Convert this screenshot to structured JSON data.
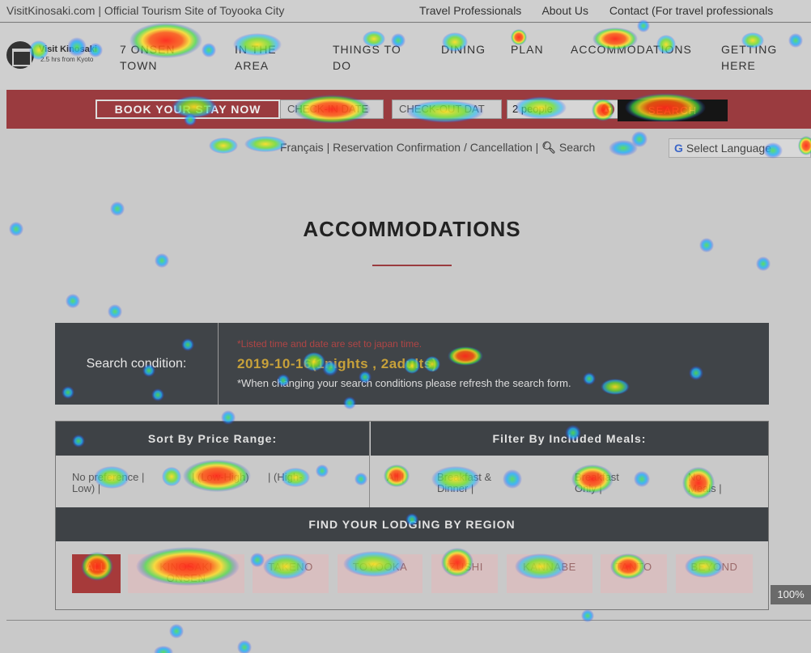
{
  "topbar": {
    "site_title": "VisitKinosaki.com | Official Tourism Site of Toyooka City",
    "links": [
      "Travel Professionals",
      "About Us",
      "Contact (For travel professionals"
    ]
  },
  "logo": {
    "name": "Visit Kinosaki",
    "tagline": "2.5 hrs from Kyoto"
  },
  "nav": {
    "items": [
      {
        "line1": "7 ONSEN",
        "line2": "TOWN"
      },
      {
        "line1": "IN THE",
        "line2": "AREA"
      },
      {
        "line1": "THINGS TO",
        "line2": "DO"
      },
      {
        "line1": "DINING",
        "line2": ""
      },
      {
        "line1": "PLAN",
        "line2": ""
      },
      {
        "line1": "ACCOMMODATIONS",
        "line2": ""
      },
      {
        "line1": "GETTING",
        "line2": "HERE"
      }
    ]
  },
  "booking": {
    "book_label": "BOOK YOUR STAY NOW",
    "checkin_placeholder": "CHECK-IN DATE",
    "checkout_placeholder": "CHECK-OUT DAT",
    "people_value": "2 people",
    "search_label": "SEARCH"
  },
  "lang_bar": {
    "links": "Français | Reservation Confirmation / Cancellation | ",
    "search_link": "Search",
    "translate_label": "Select Language"
  },
  "page": {
    "title": "ACCOMMODATIONS"
  },
  "search_condition": {
    "label": "Search condition:",
    "note": "*Listed time and date are set to japan time.",
    "dates": "2019-10-16(1nights , 2adults)",
    "hint": "*When changing your search conditions please refresh the search form."
  },
  "sort": {
    "header": "Sort By Price Range:",
    "opt_none_1": "No preference",
    "opt_none_2": "Low)",
    "opt_low_high": "Low-High",
    "opt_high_low": "High-"
  },
  "meals": {
    "header": "Filter By Included Meals:",
    "opt_all": "All",
    "opt_bd_1": "Breakfast &",
    "opt_bd_2": "Dinner",
    "opt_b_1": "Breakfast",
    "opt_b_2": "Only",
    "opt_none_1": "No",
    "opt_none_2": "Meals"
  },
  "regions": {
    "header": "FIND YOUR LODGING BY REGION",
    "items": [
      {
        "line1": "ALL",
        "line2": ""
      },
      {
        "line1": "KINOSAKI",
        "line2": "ONSEN"
      },
      {
        "line1": "TAKENO",
        "line2": ""
      },
      {
        "line1": "TOYOOKA",
        "line2": ""
      },
      {
        "line1": "IZUSHI",
        "line2": ""
      },
      {
        "line1": "KANNABE",
        "line2": ""
      },
      {
        "line1": "TANTO",
        "line2": ""
      },
      {
        "line1": "BEYOND",
        "line2": ""
      }
    ]
  },
  "zoom": {
    "level": "100%"
  },
  "colors": {
    "accent": "#9a3b3f",
    "dark_panel": "#404448",
    "date_gold": "#c7a13a",
    "heat_hot": "#ff2a1a",
    "heat_cool": "#2a3cff"
  },
  "heatmap": {
    "fixations": 76
  }
}
